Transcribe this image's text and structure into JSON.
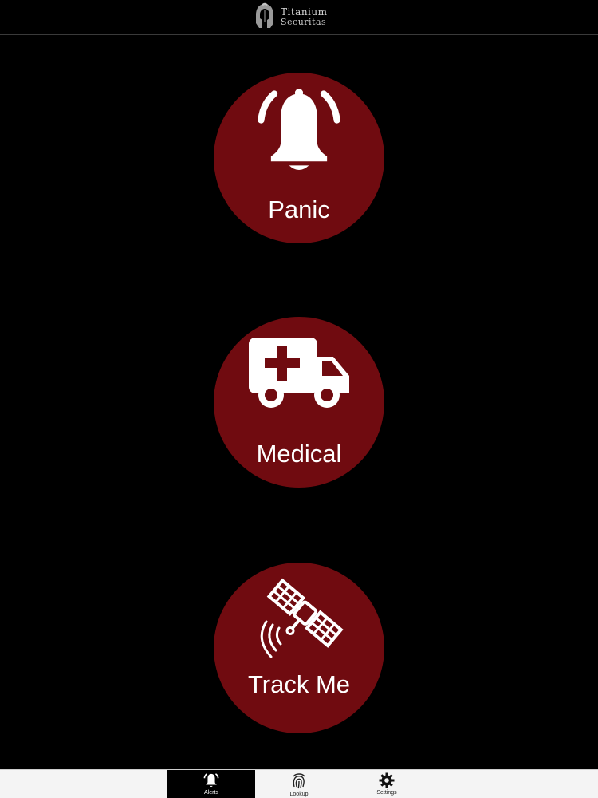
{
  "app": {
    "logo_line1": "Titanium",
    "logo_line2": "Securitas"
  },
  "alerts": [
    {
      "label": "Panic",
      "icon": "bell-icon"
    },
    {
      "label": "Medical",
      "icon": "ambulance-icon"
    },
    {
      "label": "Track Me",
      "icon": "satellite-icon"
    }
  ],
  "tabs": [
    {
      "label": "Alerts",
      "icon": "bell-icon",
      "selected": true
    },
    {
      "label": "Lookup",
      "icon": "fingerprint-icon",
      "selected": false
    },
    {
      "label": "Settings",
      "icon": "gear-icon",
      "selected": false
    }
  ],
  "colors": {
    "background": "#000000",
    "button_fill": "#700b10",
    "icon_and_text": "#ffffff",
    "tabbar": "#f4f4f4"
  }
}
